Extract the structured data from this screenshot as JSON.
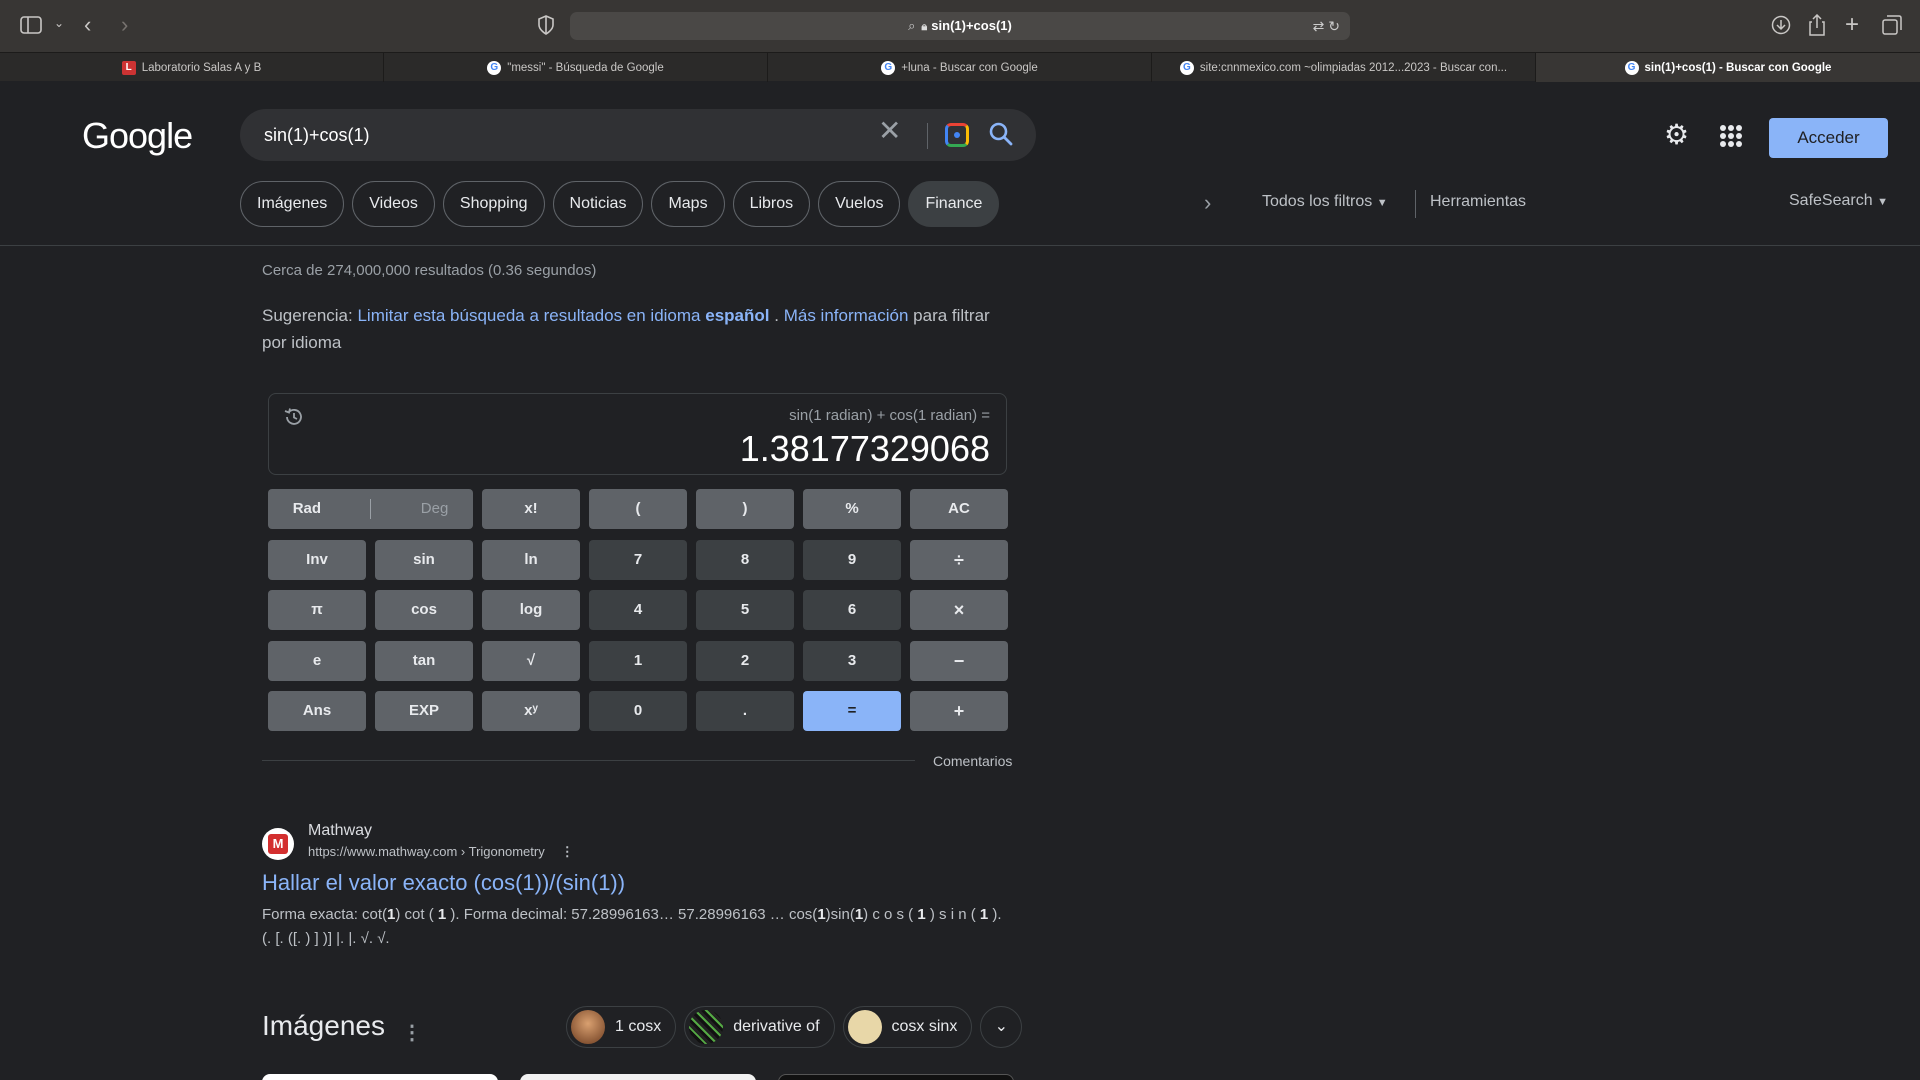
{
  "browser": {
    "address": "sin(1)+cos(1)",
    "tabs": [
      {
        "title": "Laboratorio Salas A y B",
        "active": false,
        "favicon": "lab-favicon"
      },
      {
        "title": "\"messi\" - Búsqueda de Google",
        "active": false,
        "favicon": "google-favicon"
      },
      {
        "title": "+luna - Buscar con Google",
        "active": false,
        "favicon": "google-favicon"
      },
      {
        "title": "site:cnnmexico.com ~olimpiadas 2012...2023 - Buscar con...",
        "active": false,
        "favicon": "google-favicon"
      },
      {
        "title": "sin(1)+cos(1) - Buscar con Google",
        "active": true,
        "favicon": "google-favicon"
      }
    ]
  },
  "header": {
    "logo": "Google",
    "query": "sin(1)+cos(1)",
    "signin": "Acceder",
    "chips": [
      "Imágenes",
      "Videos",
      "Shopping",
      "Noticias",
      "Maps",
      "Libros",
      "Vuelos",
      "Finance"
    ],
    "all_filters": "Todos los filtros",
    "tools": "Herramientas",
    "safesearch": "SafeSearch"
  },
  "stats": "Cerca de 274,000,000 resultados (0.36 segundos)",
  "suggestion": {
    "prefix": "Sugerencia:",
    "link1": "Limitar esta búsqueda a resultados en idioma",
    "link1_bold": "español",
    "dot": ".",
    "link2": "Más información",
    "suffix": "para filtrar por idioma"
  },
  "calculator": {
    "expression": "sin(1 radian) + cos(1 radian) =",
    "result": "1.38177329068",
    "rad": "Rad",
    "deg": "Deg",
    "keys": [
      {
        "label": "x!",
        "type": "fn",
        "name": "factorial"
      },
      {
        "label": "(",
        "type": "fn",
        "name": "open-paren"
      },
      {
        "label": ")",
        "type": "fn",
        "name": "close-paren"
      },
      {
        "label": "%",
        "type": "fn",
        "name": "percent"
      },
      {
        "label": "AC",
        "type": "fn",
        "name": "all-clear"
      },
      {
        "label": "Inv",
        "type": "fn",
        "name": "inverse"
      },
      {
        "label": "sin",
        "type": "fn",
        "name": "sin"
      },
      {
        "label": "ln",
        "type": "fn",
        "name": "ln"
      },
      {
        "label": "7",
        "type": "num",
        "name": "7"
      },
      {
        "label": "8",
        "type": "num",
        "name": "8"
      },
      {
        "label": "9",
        "type": "num",
        "name": "9"
      },
      {
        "label": "÷",
        "type": "op",
        "name": "divide"
      },
      {
        "label": "π",
        "type": "fn",
        "name": "pi"
      },
      {
        "label": "cos",
        "type": "fn",
        "name": "cos"
      },
      {
        "label": "log",
        "type": "fn",
        "name": "log"
      },
      {
        "label": "4",
        "type": "num",
        "name": "4"
      },
      {
        "label": "5",
        "type": "num",
        "name": "5"
      },
      {
        "label": "6",
        "type": "num",
        "name": "6"
      },
      {
        "label": "×",
        "type": "op",
        "name": "multiply"
      },
      {
        "label": "e",
        "type": "fn",
        "name": "e"
      },
      {
        "label": "tan",
        "type": "fn",
        "name": "tan"
      },
      {
        "label": "√",
        "type": "fn",
        "name": "sqrt"
      },
      {
        "label": "1",
        "type": "num",
        "name": "1"
      },
      {
        "label": "2",
        "type": "num",
        "name": "2"
      },
      {
        "label": "3",
        "type": "num",
        "name": "3"
      },
      {
        "label": "−",
        "type": "op",
        "name": "minus"
      },
      {
        "label": "Ans",
        "type": "fn",
        "name": "ans"
      },
      {
        "label": "EXP",
        "type": "fn",
        "name": "exp"
      },
      {
        "label": "xʸ",
        "type": "fn",
        "name": "power"
      },
      {
        "label": "0",
        "type": "num",
        "name": "0"
      },
      {
        "label": ".",
        "type": "num",
        "name": "decimal"
      },
      {
        "label": "=",
        "type": "eq",
        "name": "equals"
      },
      {
        "label": "+",
        "type": "op",
        "name": "plus"
      }
    ],
    "feedback": "Comentarios"
  },
  "result1": {
    "site": "Mathway",
    "url": "https://www.mathway.com › Trigonometry",
    "menu": "⋮",
    "title": "Hallar el valor exacto (cos(1))/(sin(1))",
    "snippet_a": "Forma exacta: cot(",
    "snippet_b": "1",
    "snippet_c": ") cot (",
    "snippet_d": "1",
    "snippet_e": "). Forma decimal: 57.28996163… 57.28996163 … cos(",
    "snippet_f": "1",
    "snippet_g": ")sin(",
    "snippet_h": "1",
    "snippet_i": ") c o s (",
    "snippet_j": "1",
    "snippet_k": ") s i n (",
    "snippet_l": "1",
    "snippet_m": "). (. [. ([. ) ] )] |. |. √. √."
  },
  "images": {
    "heading": "Imágenes",
    "menu": "⋮",
    "chips": [
      "1 cosx",
      "derivative of",
      "cosx sinx"
    ]
  },
  "colors": {
    "background": "#202124",
    "link": "#8ab4f8",
    "accent_button": "#8ab4f8",
    "key_function": "#5f6368",
    "key_number": "#3c4043"
  }
}
